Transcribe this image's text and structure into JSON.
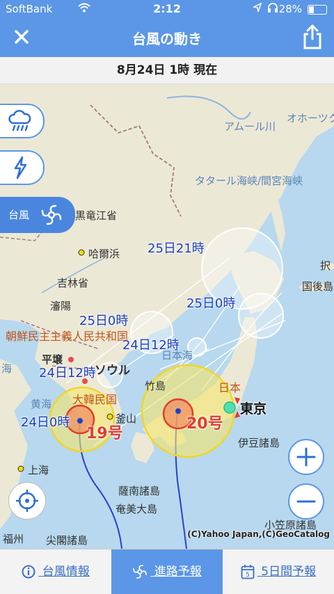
{
  "status": {
    "carrier": "SoftBank",
    "time": "2:12",
    "battery": "28%"
  },
  "header": {
    "title": "台風の動き"
  },
  "date_bar": {
    "text": "8月24日 1時 現在"
  },
  "side": {
    "typhoon_label": "台風"
  },
  "map": {
    "places": {
      "amur": "アムール川",
      "okhotsk": "オホーツク",
      "tatar": "タタール海峡/間宮海峡",
      "heilongjiang": "黒竜江省",
      "harbin": "哈爾浜",
      "jilin": "吉林省",
      "shenyang": "瀋陽",
      "etorofu": "択",
      "kunashiri": "国後島",
      "dprk": "朝鮮民主主義人民共和国",
      "pyongyang": "平壌",
      "seoul": "ソウル",
      "sea_of_japan": "日本海",
      "takeshima": "竹島",
      "japan": "日本",
      "korea": "大韓民国",
      "yellow_sea": "黄海",
      "busan": "釜山",
      "izu": "伊豆諸島",
      "shanghai": "上海",
      "satsunan": "薩南諸島",
      "amami": "奄美大島",
      "ogasawara": "小笠原諸島",
      "fuzhou": "福州",
      "senkaku": "尖閣諸島",
      "tokyo": "東京",
      "he": "海"
    },
    "track_labels": {
      "t25_21": "25日21時",
      "t25_0_east": "25日0時",
      "t25_0_west": "25日0時",
      "t24_12_east": "24日12時",
      "t24_12_west": "24日12時",
      "t24_0": "24日0時"
    },
    "typhoons": {
      "t19": "19号",
      "t20": "20号"
    },
    "copyright": "(C)Yahoo Japan,(C)GeoCatalog"
  },
  "tabs": [
    {
      "label": "台風情報"
    },
    {
      "label": "進路予報"
    },
    {
      "label": "5日間予報",
      "icon_number": "5"
    }
  ],
  "colors": {
    "header": "#5b97e6",
    "track_label": "#1c3fc4",
    "typhoon_label": "#e23c2f",
    "storm_area": "#f5e66a"
  }
}
